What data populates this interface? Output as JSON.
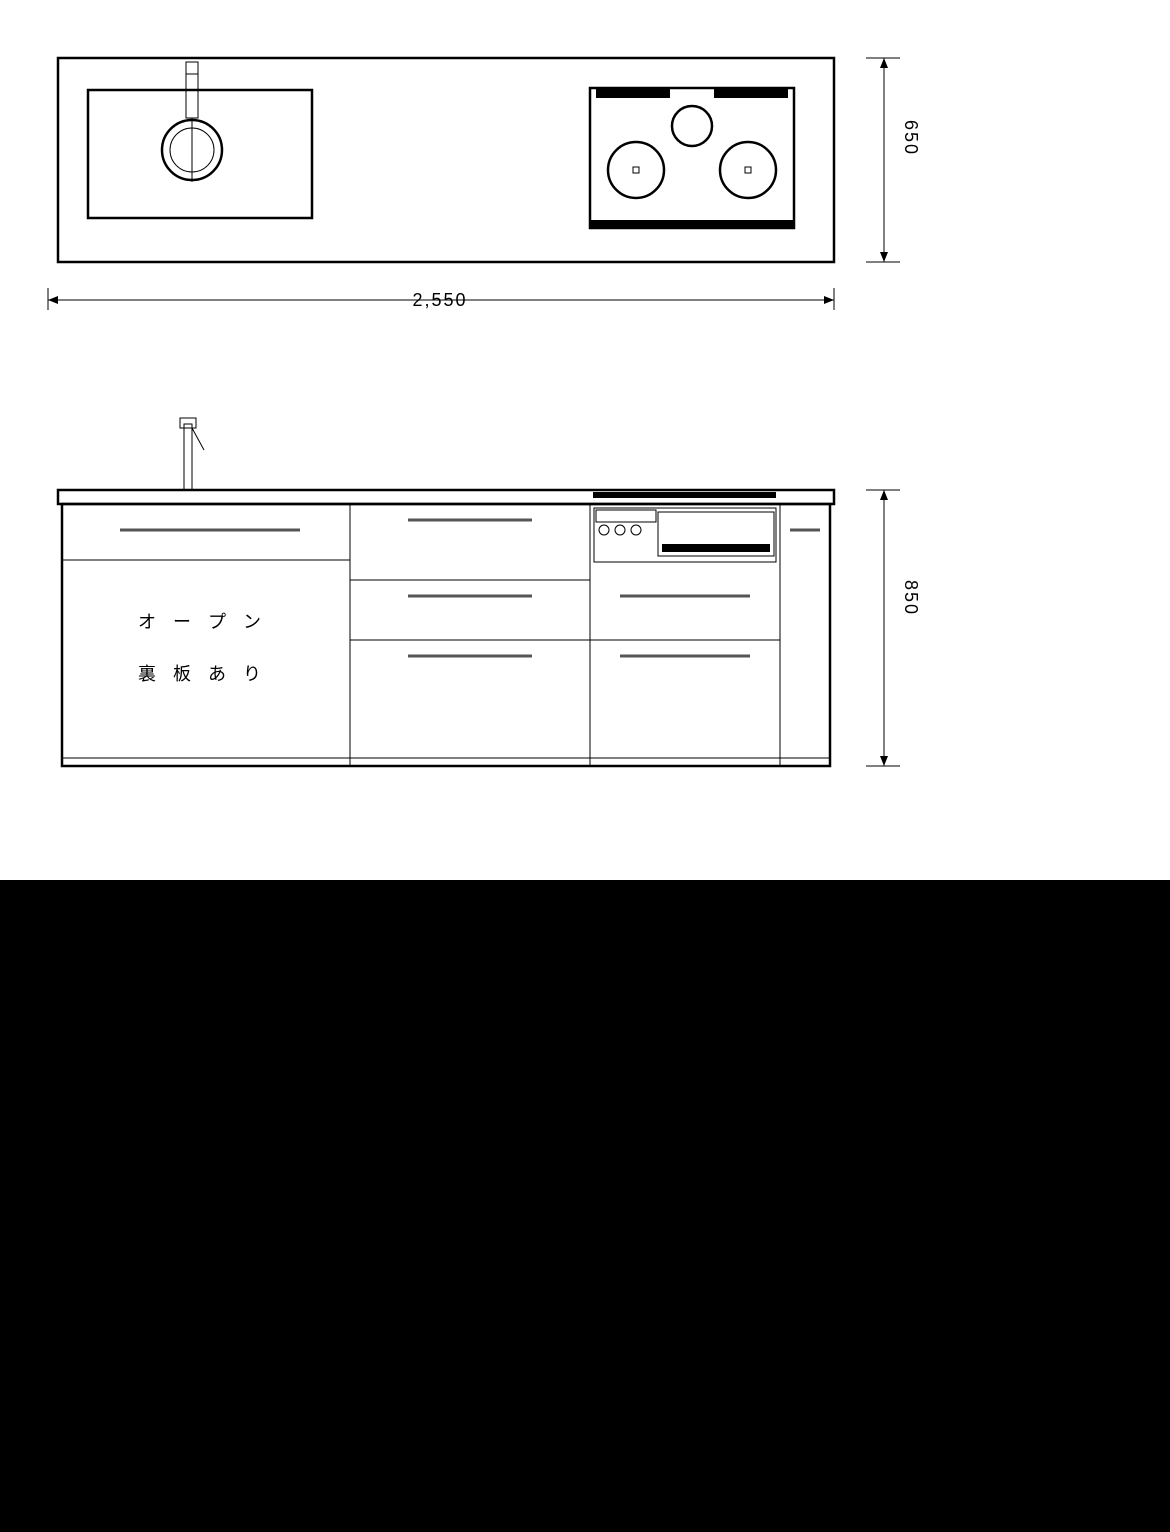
{
  "dimensions": {
    "width_label": "2,550",
    "depth_label": "650",
    "height_label": "850"
  },
  "annotations": {
    "open_area_line1": "オ ー プ ン",
    "open_area_line2": "裏 板 あ り"
  }
}
